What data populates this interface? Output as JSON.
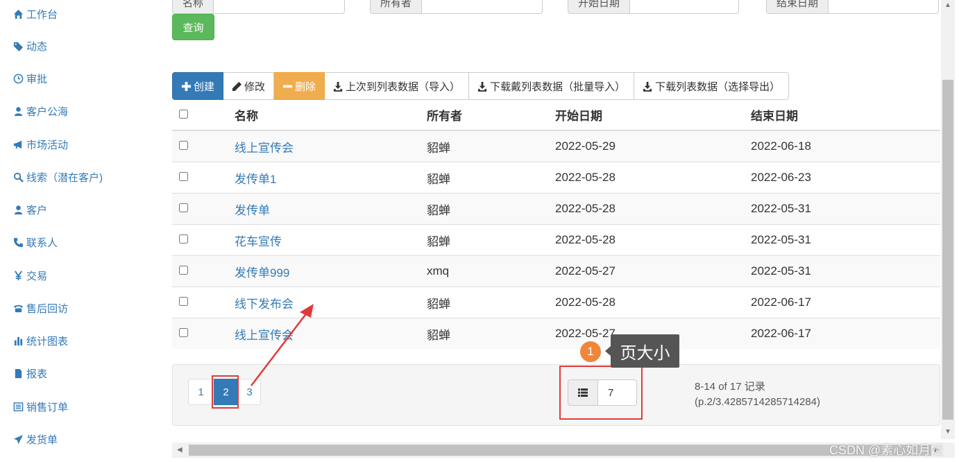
{
  "sidebar": {
    "items": [
      {
        "label": "工作台",
        "icon": "home-icon"
      },
      {
        "label": "动态",
        "icon": "tags-icon"
      },
      {
        "label": "审批",
        "icon": "clock-icon"
      },
      {
        "label": "客户公海",
        "icon": "user-icon"
      },
      {
        "label": "市场活动",
        "icon": "bullhorn-icon"
      },
      {
        "label": "线索（潜在客户)",
        "icon": "search-icon"
      },
      {
        "label": "客户",
        "icon": "user-icon"
      },
      {
        "label": "联系人",
        "icon": "phone-icon"
      },
      {
        "label": "交易",
        "icon": "yen-icon"
      },
      {
        "label": "售后回访",
        "icon": "phone-alt-icon"
      },
      {
        "label": "统计图表",
        "icon": "stats-icon"
      },
      {
        "label": "报表",
        "icon": "file-icon"
      },
      {
        "label": "销售订单",
        "icon": "list-alt-icon"
      },
      {
        "label": "发货单",
        "icon": "send-icon"
      }
    ]
  },
  "filters": {
    "name_label": "名称",
    "owner_label": "所有者",
    "start_label": "开始日期",
    "end_label": "结束日期",
    "query_label": "查询"
  },
  "toolbar": {
    "create": "创建",
    "edit": "修改",
    "delete": "删除",
    "import": "上次到列表数据（导入）",
    "download_template": "下载戴列表数据（批量导入）",
    "export": "下载列表数据（选择导出）"
  },
  "table": {
    "headers": {
      "name": "名称",
      "owner": "所有者",
      "start": "开始日期",
      "end": "结束日期"
    },
    "rows": [
      {
        "name": "线上宣传会",
        "owner": "貂蝉",
        "start": "2022-05-29",
        "end": "2022-06-18"
      },
      {
        "name": "发传单1",
        "owner": "貂蝉",
        "start": "2022-05-28",
        "end": "2022-06-23"
      },
      {
        "name": "发传单",
        "owner": "貂蝉",
        "start": "2022-05-28",
        "end": "2022-05-31"
      },
      {
        "name": "花车宣传",
        "owner": "貂蝉",
        "start": "2022-05-28",
        "end": "2022-05-31"
      },
      {
        "name": "发传单999",
        "owner": "xmq",
        "start": "2022-05-27",
        "end": "2022-05-31"
      },
      {
        "name": "线下发布会",
        "owner": "貂蝉",
        "start": "2022-05-28",
        "end": "2022-06-17"
      },
      {
        "name": "线上宣传会",
        "owner": "貂蝉",
        "start": "2022-05-27",
        "end": "2022-06-17"
      }
    ]
  },
  "pagination": {
    "pages": [
      "1",
      "2",
      "3"
    ],
    "active": "2",
    "page_size": "7",
    "record_info_line1": "8-14 of 17 记录",
    "record_info_line2": "(p.2/3.4285714285714284)"
  },
  "annotation": {
    "badge": "1",
    "tooltip": "页大小"
  },
  "watermark": "CSDN @素心如月娅"
}
